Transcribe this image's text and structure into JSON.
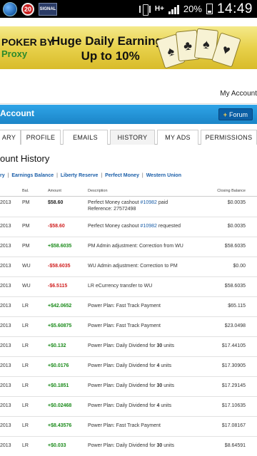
{
  "status_bar": {
    "notif_count": "20",
    "app_label": "SIGNAL",
    "network": "H+",
    "battery": "20%",
    "time": "14:49"
  },
  "banner": {
    "left_title": "POKER BY",
    "left_sub": "Proxy",
    "headline_1": "Huge Daily Earnings",
    "headline_2": "Up to 10%",
    "cards": [
      "♠",
      "♣",
      "♠",
      "♥"
    ]
  },
  "account_link": "My Account",
  "header": {
    "title": "Account",
    "forum_button": "Forum"
  },
  "tabs": [
    "ARY",
    "PROFILE",
    "EMAILS",
    "HISTORY",
    "MY ADS",
    "PERMISSIONS"
  ],
  "active_tab": "HISTORY",
  "page_title": "ount History",
  "filters": {
    "current": "ry",
    "links": [
      "Earnings Balance",
      "Liberty Reserve",
      "Perfect Money",
      "Western Union"
    ]
  },
  "table": {
    "headers": {
      "bal": "Bal.",
      "amount": "Amount",
      "description": "Description",
      "closing": "Closing Balance"
    },
    "rows": [
      {
        "date": "2013",
        "bal": "PM",
        "amount": "$58.60",
        "amount_color": "dark",
        "desc_prefix": "Perfect Money cashout ",
        "desc_ref": "#10982",
        "desc_suffix": " paid",
        "desc_line2": "Reference: 27572498",
        "closing": "$0.0035"
      },
      {
        "date": "2013",
        "bal": "PM",
        "amount": "-$58.60",
        "amount_color": "red",
        "desc_prefix": "Perfect Money cashout ",
        "desc_ref": "#10982",
        "desc_suffix": " requested",
        "desc_line2": "",
        "closing": "$0.0035"
      },
      {
        "date": "2013",
        "bal": "PM",
        "amount": "+$58.6035",
        "amount_color": "green",
        "desc_prefix": "PM Admin adjustment: Correction from WU",
        "desc_ref": "",
        "desc_suffix": "",
        "desc_line2": "",
        "closing": "$58.6035"
      },
      {
        "date": "2013",
        "bal": "WU",
        "amount": "-$58.6035",
        "amount_color": "red",
        "desc_prefix": "WU Admin adjustment: Correction to PM",
        "desc_ref": "",
        "desc_suffix": "",
        "desc_line2": "",
        "closing": "$0.00"
      },
      {
        "date": "2013",
        "bal": "WU",
        "amount": "-$6.5115",
        "amount_color": "red",
        "desc_prefix": "LR eCurrency transfer to WU",
        "desc_ref": "",
        "desc_suffix": "",
        "desc_line2": "",
        "closing": "$58.6035"
      },
      {
        "date": "2013",
        "bal": "LR",
        "amount": "+$42.0652",
        "amount_color": "green",
        "desc_prefix": "Power Plan: Fast Track Payment",
        "desc_ref": "",
        "desc_suffix": "",
        "desc_line2": "",
        "closing": "$65.115"
      },
      {
        "date": "2013",
        "bal": "LR",
        "amount": "+$5.60875",
        "amount_color": "green",
        "desc_prefix": "Power Plan: Fast Track Payment",
        "desc_ref": "",
        "desc_suffix": "",
        "desc_line2": "",
        "closing": "$23.0498"
      },
      {
        "date": "2013",
        "bal": "LR",
        "amount": "+$0.132",
        "amount_color": "green",
        "desc_prefix": "Power Plan: Daily Dividend for ",
        "desc_bold": "30",
        "desc_tail": " units",
        "closing": "$17.44105"
      },
      {
        "date": "2013",
        "bal": "LR",
        "amount": "+$0.0176",
        "amount_color": "green",
        "desc_prefix": "Power Plan: Daily Dividend for ",
        "desc_bold": "4",
        "desc_tail": " units",
        "closing": "$17.30905"
      },
      {
        "date": "2013",
        "bal": "LR",
        "amount": "+$0.1851",
        "amount_color": "green",
        "desc_prefix": "Power Plan: Daily Dividend for ",
        "desc_bold": "30",
        "desc_tail": " units",
        "closing": "$17.29145"
      },
      {
        "date": "2013",
        "bal": "LR",
        "amount": "+$0.02468",
        "amount_color": "green",
        "desc_prefix": "Power Plan: Daily Dividend for ",
        "desc_bold": "4",
        "desc_tail": " units",
        "closing": "$17.10635"
      },
      {
        "date": "2013",
        "bal": "LR",
        "amount": "+$8.43576",
        "amount_color": "green",
        "desc_prefix": "Power Plan: Fast Track Payment",
        "desc_ref": "",
        "desc_suffix": "",
        "desc_line2": "",
        "closing": "$17.08167"
      },
      {
        "date": "2013",
        "bal": "LR",
        "amount": "+$0.033",
        "amount_color": "green",
        "desc_prefix": "Power Plan: Daily Dividend for ",
        "desc_bold": "30",
        "desc_tail": " units",
        "closing": "$8.64591"
      }
    ]
  }
}
